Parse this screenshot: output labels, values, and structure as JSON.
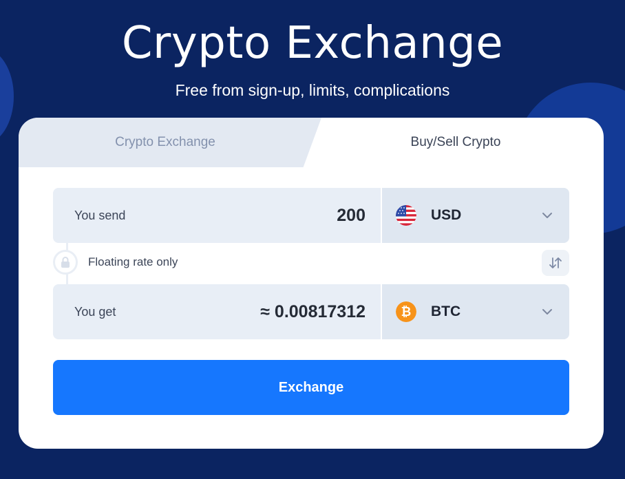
{
  "hero": {
    "title": "Crypto Exchange",
    "subtitle": "Free from sign-up, limits, complications"
  },
  "tabs": [
    {
      "label": "Crypto Exchange",
      "active": false
    },
    {
      "label": "Buy/Sell Crypto",
      "active": true
    }
  ],
  "send": {
    "label": "You send",
    "amount": "200",
    "currency": "USD",
    "icon": "us-flag-icon"
  },
  "rate": {
    "label": "Floating rate only",
    "icon": "lock-icon"
  },
  "get": {
    "label": "You get",
    "amount": "≈ 0.00817312",
    "currency": "BTC",
    "icon": "bitcoin-icon"
  },
  "action": {
    "label": "Exchange"
  },
  "colors": {
    "background": "#0b2461",
    "accent": "#1677fe",
    "bitcoin": "#f7931a"
  }
}
